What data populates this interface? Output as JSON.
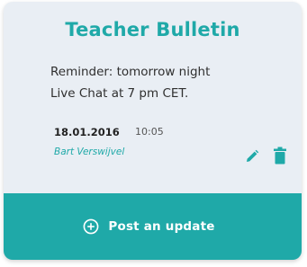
{
  "card": {
    "title": "Teacher Bulletin",
    "message_line1": "Reminder: tomorrow night",
    "message_line2": "Live Chat at 7 pm CET.",
    "date": "18.01.2016",
    "time": "10:05",
    "author": "Bart Verswijvel",
    "edit_icon": "pencil-icon",
    "delete_icon": "trash-icon"
  },
  "footer": {
    "button_label": "Post an update",
    "button_icon": "plus-circle-icon"
  },
  "colors": {
    "accent": "#1fa9a8",
    "card_background": "#e9eef4",
    "text": "#2f2f2f"
  }
}
